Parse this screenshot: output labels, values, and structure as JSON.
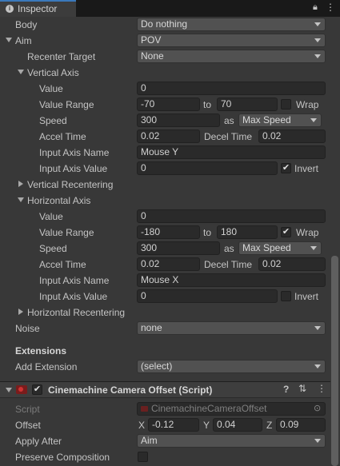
{
  "tab": {
    "title": "Inspector"
  },
  "rows": {
    "body": {
      "label": "Body",
      "value": "Do nothing"
    },
    "aim": {
      "label": "Aim",
      "value": "POV"
    },
    "recenter_target": {
      "label": "Recenter Target",
      "value": "None"
    },
    "vertical_axis": {
      "label": "Vertical Axis",
      "value_label": "Value",
      "value": "0",
      "range_label": "Value Range",
      "range_min": "-70",
      "to": "to",
      "range_max": "70",
      "wrap_label": "Wrap",
      "speed_label": "Speed",
      "speed": "300",
      "as": "as",
      "speed_mode": "Max Speed",
      "accel_label": "Accel Time",
      "accel": "0.02",
      "decel_label": "Decel Time",
      "decel": "0.02",
      "input_name_label": "Input Axis Name",
      "input_name": "Mouse Y",
      "input_value_label": "Input Axis Value",
      "input_value": "0",
      "invert_label": "Invert"
    },
    "vertical_recentering": {
      "label": "Vertical Recentering"
    },
    "horizontal_axis": {
      "label": "Horizontal Axis",
      "value_label": "Value",
      "value": "0",
      "range_label": "Value Range",
      "range_min": "-180",
      "to": "to",
      "range_max": "180",
      "wrap_label": "Wrap",
      "speed_label": "Speed",
      "speed": "300",
      "as": "as",
      "speed_mode": "Max Speed",
      "accel_label": "Accel Time",
      "accel": "0.02",
      "decel_label": "Decel Time",
      "decel": "0.02",
      "input_name_label": "Input Axis Name",
      "input_name": "Mouse X",
      "input_value_label": "Input Axis Value",
      "input_value": "0",
      "invert_label": "Invert"
    },
    "horizontal_recentering": {
      "label": "Horizontal Recentering"
    },
    "noise": {
      "label": "Noise",
      "value": "none"
    }
  },
  "extensions": {
    "title": "Extensions",
    "add_label": "Add Extension",
    "add_value": "(select)"
  },
  "component": {
    "title": "Cinemachine Camera Offset (Script)",
    "script_label": "Script",
    "script_value": "CinemachineCameraOffset",
    "offset_label": "Offset",
    "x_label": "X",
    "x": "-0.12",
    "y_label": "Y",
    "y": "0.04",
    "z_label": "Z",
    "z": "0.09",
    "apply_after_label": "Apply After",
    "apply_after": "Aim",
    "preserve_label": "Preserve Composition"
  }
}
